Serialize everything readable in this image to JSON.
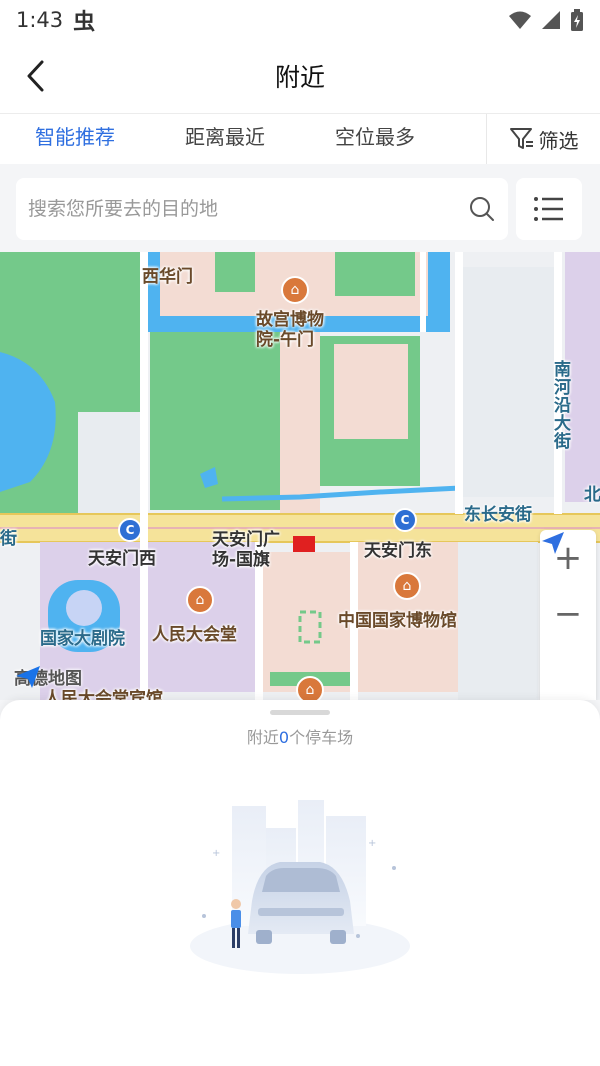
{
  "status_bar": {
    "time": "1:43",
    "bug_icon": "虫"
  },
  "header": {
    "title": "附近"
  },
  "tabs": [
    {
      "label": "智能推荐",
      "active": true
    },
    {
      "label": "距离最近",
      "active": false
    },
    {
      "label": "空位最多",
      "active": false
    }
  ],
  "filter": {
    "label": "筛选"
  },
  "search": {
    "placeholder": "搜索您所要去的目的地"
  },
  "map": {
    "labels": {
      "xihuamen": "西华门",
      "gugong": "故宫博物院-午门",
      "nanheyan": "南河沿大街",
      "dongchangan": "东长安街",
      "jie": "街",
      "bei": "北",
      "tiananmen_west": "天安门西",
      "tiananmen_square": "天安门广场-国旗",
      "tiananmen_east": "天安门东",
      "national_theater": "国家大剧院",
      "great_hall": "人民大会堂",
      "national_museum": "中国国家博物馆",
      "great_hall_hotel": "人民大会堂宾馆"
    },
    "logo": "高德地图",
    "zoom_in": "+",
    "zoom_out": "−"
  },
  "sheet": {
    "prefix": "附近",
    "count": "0",
    "suffix": "个停车场"
  },
  "colors": {
    "accent": "#2f6fe0",
    "water": "#4fb3f0",
    "park": "#74c98a",
    "building": "#f3dcd3",
    "road": "#f5e39a"
  }
}
